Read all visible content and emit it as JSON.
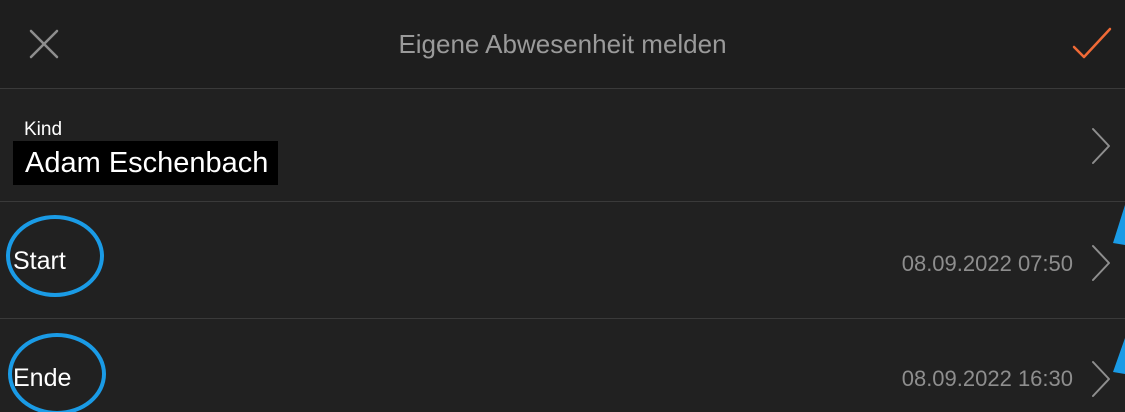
{
  "header": {
    "title": "Eigene Abwesenheit melden",
    "close_icon": "close-x-icon",
    "confirm_icon": "checkmark-icon",
    "confirm_color": "#f06a36"
  },
  "form": {
    "kind": {
      "label": "Kind",
      "value": "Adam Eschenbach"
    },
    "start": {
      "label": "Start",
      "value": "08.09.2022 07:50"
    },
    "end": {
      "label": "Ende",
      "value": "08.09.2022 16:30"
    }
  },
  "annotations": {
    "color": "#1a9be6"
  }
}
